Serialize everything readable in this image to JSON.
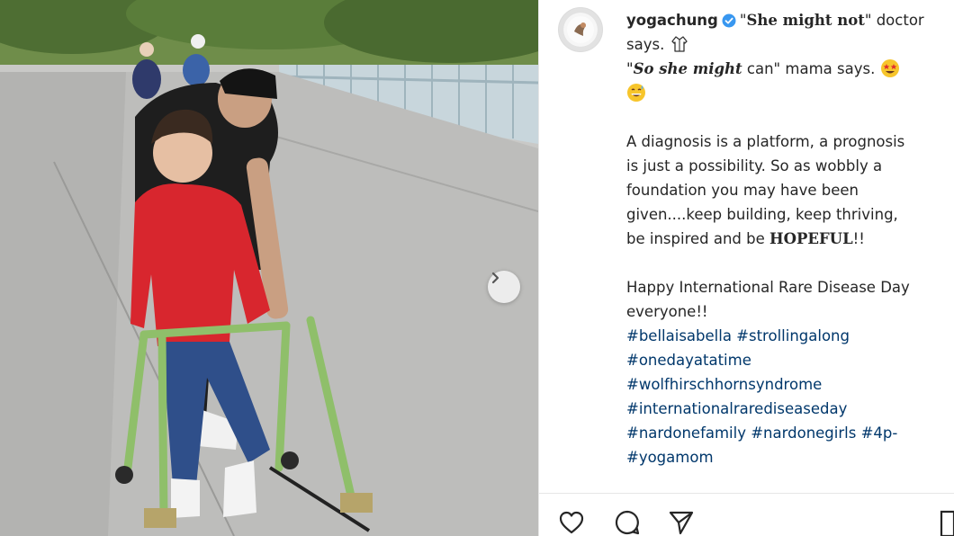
{
  "post": {
    "username": "yogachung",
    "caption": {
      "l1_q1": "\"",
      "l1_bold": "She might not",
      "l1_q2": "\"",
      "l1_tail": " doctor",
      "l2": "says.",
      "l3_q1": "\"",
      "l3_bold": "So she might",
      "l3_mid": " can\" mama says.",
      "p2": [
        "A diagnosis is a platform, a prognosis",
        "is just a possibility. So as wobbly a",
        "foundation you may have been",
        "given....keep building, keep thriving,"
      ],
      "p2_last_pre": "be inspired and be ",
      "p2_last_bold": "HOPEFUL",
      "p2_last_post": "!!",
      "p3": [
        "Happy International Rare Disease Day",
        "everyone!!"
      ],
      "hashtags": [
        "#bellaisabella #strollingalong",
        "#onedayatatime",
        "#wolfhirschhornsyndrome",
        "#internationalrarediseaseday",
        "#nardonefamily #nardonegirls #4p-",
        "#yogamom"
      ]
    }
  },
  "icons": {
    "verified": "verified-badge-icon",
    "doctor": "doctor-coat-emoji",
    "star_struck": "star-struck-emoji",
    "grinning_sweat": "grinning-sweat-emoji",
    "next": "chevron-right-icon",
    "like": "heart-icon",
    "comment": "comment-icon",
    "share": "paper-plane-icon",
    "save": "bookmark-icon"
  },
  "colors": {
    "text": "#262626",
    "verified": "#3897f0",
    "hashtag": "#00376b",
    "shirt": "#d8262e",
    "walker": "#8fbf6a"
  }
}
